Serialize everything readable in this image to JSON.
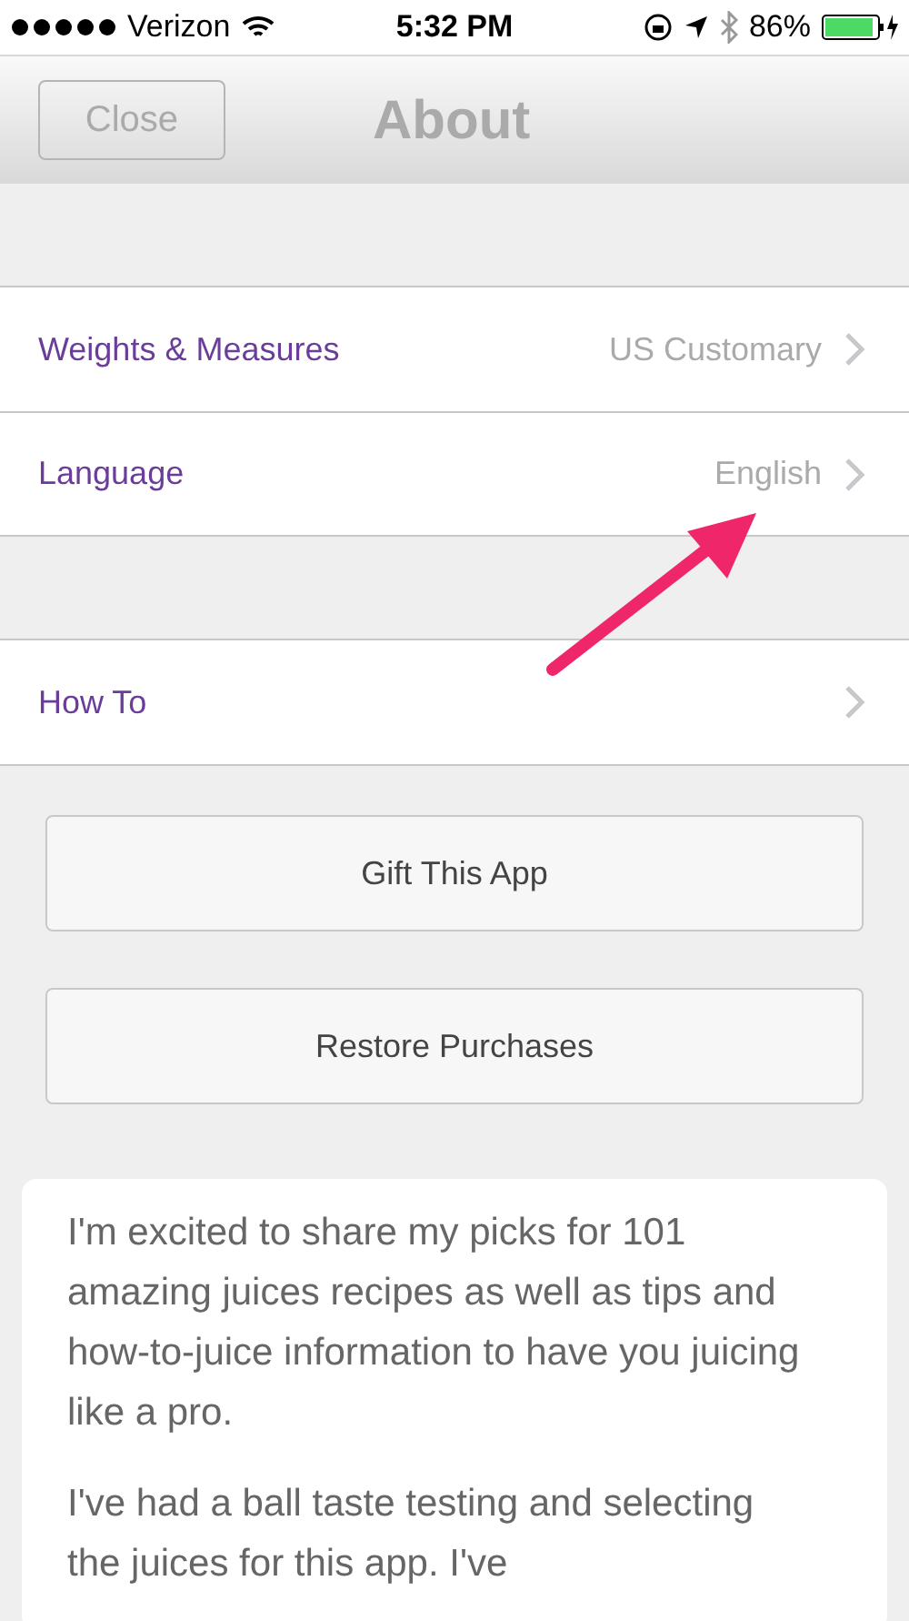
{
  "status_bar": {
    "carrier": "Verizon",
    "time": "5:32 PM",
    "battery": "86%"
  },
  "nav_bar": {
    "close": "Close",
    "title": "About"
  },
  "settings_groups": [
    [
      {
        "label": "Weights & Measures",
        "value": "US Customary"
      },
      {
        "label": "Language",
        "value": "English"
      }
    ],
    [
      {
        "label": "How To"
      }
    ]
  ],
  "buttons": [
    "Gift This App",
    "Restore Purchases"
  ],
  "about_text": [
    "I'm excited to share my picks for 101 amazing juices recipes as well as tips and how-to-juice information to have you juicing like a pro.",
    "I've had a ball taste testing and selecting the juices for this app. I've"
  ]
}
